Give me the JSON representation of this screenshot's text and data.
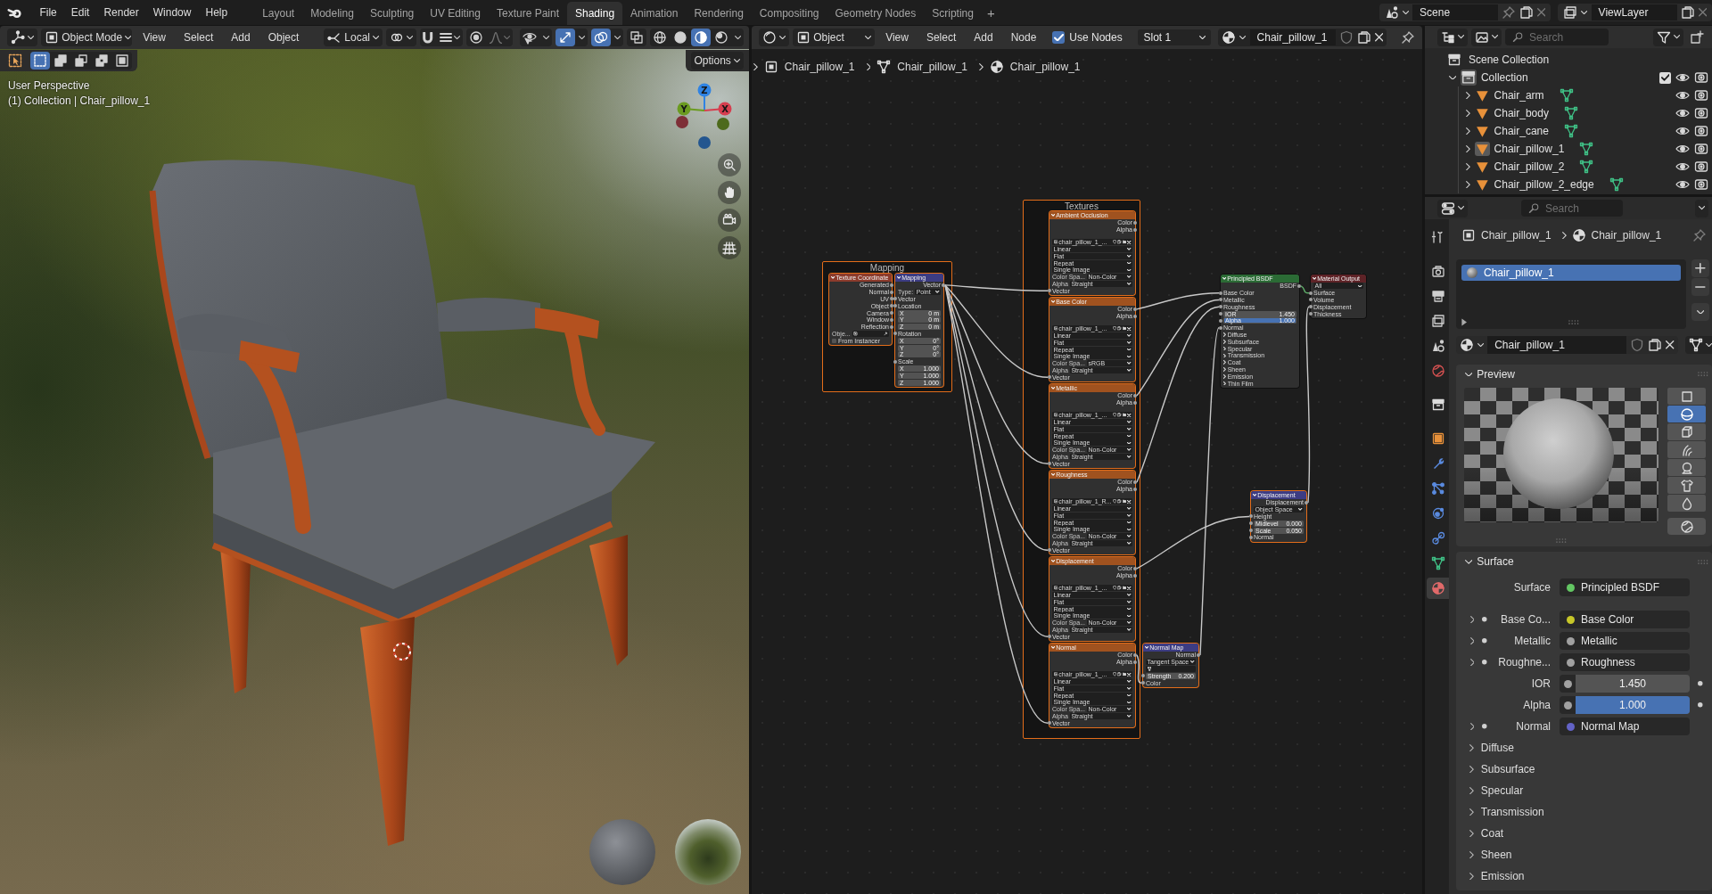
{
  "topbar": {
    "menus": [
      "File",
      "Edit",
      "Render",
      "Window",
      "Help"
    ],
    "workspaces": [
      {
        "label": "Layout",
        "selected": false
      },
      {
        "label": "Modeling",
        "selected": false
      },
      {
        "label": "Sculpting",
        "selected": false
      },
      {
        "label": "UV Editing",
        "selected": false
      },
      {
        "label": "Texture Paint",
        "selected": false
      },
      {
        "label": "Shading",
        "selected": true
      },
      {
        "label": "Animation",
        "selected": false
      },
      {
        "label": "Rendering",
        "selected": false
      },
      {
        "label": "Compositing",
        "selected": false
      },
      {
        "label": "Geometry Nodes",
        "selected": false
      },
      {
        "label": "Scripting",
        "selected": false
      }
    ],
    "add_workspace": "+",
    "scene": "Scene",
    "view_layer": "ViewLayer"
  },
  "viewport": {
    "mode": "Object Mode",
    "menus": [
      "View",
      "Select",
      "Add",
      "Object"
    ],
    "orientation": "Local",
    "toggles": [
      {
        "kind": "visibility",
        "selected": false
      },
      {
        "kind": "gizmo",
        "selected": true
      },
      {
        "kind": "overlay",
        "selected": true
      },
      {
        "kind": "xray",
        "selected": false
      }
    ],
    "shading": [
      {
        "kind": "wireframe",
        "selected": false
      },
      {
        "kind": "solid",
        "selected": false
      },
      {
        "kind": "material",
        "selected": true
      },
      {
        "kind": "rendered",
        "selected": false
      }
    ],
    "select_modes": [
      {
        "kind": "set",
        "selected": true
      },
      {
        "kind": "extend",
        "selected": false
      },
      {
        "kind": "subtract",
        "selected": false
      },
      {
        "kind": "invert",
        "selected": false
      },
      {
        "kind": "intersect",
        "selected": false
      }
    ],
    "options": "Options",
    "view_name": "User Perspective",
    "context": "(1) Collection | Chair_pillow_1",
    "axes": [
      "Z",
      "Y",
      "X"
    ]
  },
  "node_editor": {
    "object_type": "Object",
    "menus": [
      "View",
      "Select",
      "Add",
      "Node"
    ],
    "use_nodes": {
      "label": "Use Nodes",
      "checked": true
    },
    "slot": "Slot 1",
    "material": "Chair_pillow_1",
    "breadcrumbs": [
      {
        "kind": "object",
        "label": "Chair_pillow_1"
      },
      {
        "kind": "mesh",
        "label": "Chair_pillow_1"
      },
      {
        "kind": "material",
        "label": "Chair_pillow_1"
      }
    ],
    "frames": [
      {
        "label": "Mapping",
        "selected": true,
        "nodes": [
          {
            "title": "Texture Coordinate",
            "color": "#8c3b2c",
            "selected": true,
            "rows": [
              {
                "kind": "out",
                "label": "Generated"
              },
              {
                "kind": "out",
                "label": "Normal"
              },
              {
                "kind": "out",
                "label": "UV"
              },
              {
                "kind": "out",
                "label": "Object"
              },
              {
                "kind": "out",
                "label": "Camera"
              },
              {
                "kind": "out",
                "label": "Window"
              },
              {
                "kind": "out",
                "label": "Reflection"
              },
              {
                "kind": "object",
                "label": "Obje..."
              },
              {
                "kind": "check",
                "label": "From Instancer",
                "checked": false
              }
            ]
          },
          {
            "title": "Mapping",
            "color": "#3c3c83",
            "selected": true,
            "rows": [
              {
                "kind": "out",
                "label": "Vector"
              },
              {
                "kind": "field",
                "label": "Type:",
                "value": "Point"
              },
              {
                "kind": "in",
                "label": "Vector"
              },
              {
                "kind": "in",
                "label": "Location"
              },
              {
                "kind": "value",
                "label": "X",
                "value": "0 m"
              },
              {
                "kind": "value",
                "label": "Y",
                "value": "0 m"
              },
              {
                "kind": "value",
                "label": "Z",
                "value": "0 m"
              },
              {
                "kind": "in",
                "label": "Rotation"
              },
              {
                "kind": "value",
                "label": "X",
                "value": "0°"
              },
              {
                "kind": "value",
                "label": "Y",
                "value": "0°"
              },
              {
                "kind": "value",
                "label": "Z",
                "value": "0°"
              },
              {
                "kind": "in",
                "label": "Scale"
              },
              {
                "kind": "value",
                "label": "X",
                "value": "1.000"
              },
              {
                "kind": "value",
                "label": "Y",
                "value": "1.000"
              },
              {
                "kind": "value",
                "label": "Z",
                "value": "1.000"
              }
            ]
          }
        ]
      },
      {
        "label": "Textures",
        "selected": true,
        "nodes": [
          {
            "title": "Ambient Occlusion",
            "color": "#a0521f",
            "selected": true,
            "rows": [
              {
                "kind": "out",
                "label": "Color"
              },
              {
                "kind": "out",
                "label": "Alpha"
              },
              {
                "kind": "image",
                "value": "chair_pillow_1_..."
              },
              {
                "kind": "field",
                "value": "Linear"
              },
              {
                "kind": "field",
                "value": "Flat"
              },
              {
                "kind": "field",
                "value": "Repeat"
              },
              {
                "kind": "field",
                "value": "Single Image"
              },
              {
                "kind": "field",
                "label": "Color Spa...",
                "value": "Non-Color"
              },
              {
                "kind": "field",
                "label": "Alpha",
                "value": "Straight"
              },
              {
                "kind": "in",
                "label": "Vector"
              }
            ]
          },
          {
            "title": "Base Color",
            "color": "#a0521f",
            "selected": true,
            "rows": [
              {
                "kind": "out",
                "label": "Color"
              },
              {
                "kind": "out",
                "label": "Alpha"
              },
              {
                "kind": "image",
                "value": "chair_pillow_1_..."
              },
              {
                "kind": "field",
                "value": "Linear"
              },
              {
                "kind": "field",
                "value": "Flat"
              },
              {
                "kind": "field",
                "value": "Repeat"
              },
              {
                "kind": "field",
                "value": "Single Image"
              },
              {
                "kind": "field",
                "label": "Color Spa...",
                "value": "sRGB"
              },
              {
                "kind": "field",
                "label": "Alpha",
                "value": "Straight"
              },
              {
                "kind": "in",
                "label": "Vector"
              }
            ]
          },
          {
            "title": "Metallic",
            "color": "#a0521f",
            "selected": true,
            "rows": [
              {
                "kind": "out",
                "label": "Color"
              },
              {
                "kind": "out",
                "label": "Alpha"
              },
              {
                "kind": "image",
                "value": "chair_pillow_1_..."
              },
              {
                "kind": "field",
                "value": "Linear"
              },
              {
                "kind": "field",
                "value": "Flat"
              },
              {
                "kind": "field",
                "value": "Repeat"
              },
              {
                "kind": "field",
                "value": "Single Image"
              },
              {
                "kind": "field",
                "label": "Color Spa...",
                "value": "Non-Color"
              },
              {
                "kind": "field",
                "label": "Alpha",
                "value": "Straight"
              },
              {
                "kind": "in",
                "label": "Vector"
              }
            ]
          },
          {
            "title": "Roughness",
            "color": "#a0521f",
            "selected": true,
            "rows": [
              {
                "kind": "out",
                "label": "Color"
              },
              {
                "kind": "out",
                "label": "Alpha"
              },
              {
                "kind": "image",
                "value": "chair_pillow_1_R..."
              },
              {
                "kind": "field",
                "value": "Linear"
              },
              {
                "kind": "field",
                "value": "Flat"
              },
              {
                "kind": "field",
                "value": "Repeat"
              },
              {
                "kind": "field",
                "value": "Single Image"
              },
              {
                "kind": "field",
                "label": "Color Spa...",
                "value": "Non-Color"
              },
              {
                "kind": "field",
                "label": "Alpha",
                "value": "Straight"
              },
              {
                "kind": "in",
                "label": "Vector"
              }
            ]
          },
          {
            "title": "Displacement",
            "color": "#a0521f",
            "selected": true,
            "rows": [
              {
                "kind": "out",
                "label": "Color"
              },
              {
                "kind": "out",
                "label": "Alpha"
              },
              {
                "kind": "image",
                "value": "chair_pillow_1_..."
              },
              {
                "kind": "field",
                "value": "Linear"
              },
              {
                "kind": "field",
                "value": "Flat"
              },
              {
                "kind": "field",
                "value": "Repeat"
              },
              {
                "kind": "field",
                "value": "Single Image"
              },
              {
                "kind": "field",
                "label": "Color Spa...",
                "value": "Non-Color"
              },
              {
                "kind": "field",
                "label": "Alpha",
                "value": "Straight"
              },
              {
                "kind": "in",
                "label": "Vector"
              }
            ]
          },
          {
            "title": "Normal",
            "color": "#a0521f",
            "selected": true,
            "rows": [
              {
                "kind": "out",
                "label": "Color"
              },
              {
                "kind": "out",
                "label": "Alpha"
              },
              {
                "kind": "image",
                "value": "chair_pillow_1_..."
              },
              {
                "kind": "field",
                "value": "Linear"
              },
              {
                "kind": "field",
                "value": "Flat"
              },
              {
                "kind": "field",
                "value": "Repeat"
              },
              {
                "kind": "field",
                "value": "Single Image"
              },
              {
                "kind": "field",
                "label": "Color Spa...",
                "value": "Non-Color"
              },
              {
                "kind": "field",
                "label": "Alpha",
                "value": "Straight"
              },
              {
                "kind": "in",
                "label": "Vector"
              }
            ]
          }
        ]
      }
    ],
    "nodes": [
      {
        "title": "Principled BSDF",
        "color": "#2b6b35",
        "selected": false,
        "rows": [
          {
            "kind": "out",
            "label": "BSDF"
          },
          {
            "kind": "in",
            "label": "Base Color"
          },
          {
            "kind": "in",
            "label": "Metallic"
          },
          {
            "kind": "in",
            "label": "Roughness"
          },
          {
            "kind": "in_value",
            "label": "IOR",
            "value": "1.450"
          },
          {
            "kind": "in_value",
            "label": "Alpha",
            "value": "1.000",
            "level": 1
          },
          {
            "kind": "in",
            "label": "Normal"
          },
          {
            "kind": "panel",
            "label": "Diffuse"
          },
          {
            "kind": "panel",
            "label": "Subsurface"
          },
          {
            "kind": "panel",
            "label": "Specular"
          },
          {
            "kind": "panel",
            "label": "Transmission"
          },
          {
            "kind": "panel",
            "label": "Coat"
          },
          {
            "kind": "panel",
            "label": "Sheen"
          },
          {
            "kind": "panel",
            "label": "Emission"
          },
          {
            "kind": "panel",
            "label": "Thin Film"
          }
        ]
      },
      {
        "title": "Material Output",
        "color": "#5e2327",
        "selected": false,
        "rows": [
          {
            "kind": "field",
            "value": "All"
          },
          {
            "kind": "in",
            "label": "Surface"
          },
          {
            "kind": "in",
            "label": "Volume"
          },
          {
            "kind": "in",
            "label": "Displacement"
          },
          {
            "kind": "in",
            "label": "Thickness"
          }
        ]
      },
      {
        "title": "Displacement",
        "color": "#3c3c83",
        "selected": true,
        "rows": [
          {
            "kind": "out",
            "label": "Displacement"
          },
          {
            "kind": "field",
            "value": "Object Space"
          },
          {
            "kind": "in",
            "label": "Height"
          },
          {
            "kind": "in_value",
            "label": "Midlevel",
            "value": "0.000"
          },
          {
            "kind": "in_value",
            "label": "Scale",
            "value": "0.050"
          },
          {
            "kind": "in",
            "label": "Normal"
          }
        ]
      },
      {
        "title": "Normal Map",
        "color": "#3c3c83",
        "selected": true,
        "rows": [
          {
            "kind": "out",
            "label": "Normal"
          },
          {
            "kind": "field",
            "value": "Tangent Space"
          },
          {
            "kind": "uv"
          },
          {
            "kind": "in_value",
            "label": "Strength",
            "value": "0.200"
          },
          {
            "kind": "in",
            "label": "Color"
          }
        ]
      }
    ]
  },
  "outliner": {
    "search_placeholder": "Search",
    "root": "Scene Collection",
    "collections": [
      {
        "label": "Collection",
        "expanded": true,
        "checked": true,
        "children": [
          {
            "label": "Chair_arm",
            "selected": false
          },
          {
            "label": "Chair_body",
            "selected": false
          },
          {
            "label": "Chair_cane",
            "selected": false
          },
          {
            "label": "Chair_pillow_1",
            "selected": true
          },
          {
            "label": "Chair_pillow_2",
            "selected": false
          },
          {
            "label": "Chair_pillow_2_edge",
            "selected": false
          }
        ]
      }
    ]
  },
  "properties": {
    "search_placeholder": "Search",
    "tabs": [
      {
        "kind": "tool",
        "selected": false
      },
      {
        "kind": "render",
        "selected": false
      },
      {
        "kind": "output",
        "selected": false
      },
      {
        "kind": "view_layer",
        "selected": false
      },
      {
        "kind": "scene",
        "selected": false
      },
      {
        "kind": "world",
        "selected": false
      },
      {
        "kind": "collection",
        "selected": false
      },
      {
        "kind": "object",
        "selected": false
      },
      {
        "kind": "modifiers",
        "selected": false
      },
      {
        "kind": "particles",
        "selected": false
      },
      {
        "kind": "physics",
        "selected": false
      },
      {
        "kind": "constraints",
        "selected": false
      },
      {
        "kind": "data",
        "selected": false
      },
      {
        "kind": "material",
        "selected": true
      }
    ],
    "breadcrumbs": [
      {
        "kind": "object",
        "label": "Chair_pillow_1"
      },
      {
        "kind": "material",
        "label": "Chair_pillow_1"
      }
    ],
    "material_slots": [
      {
        "label": "Chair_pillow_1",
        "selected": true
      }
    ],
    "material": "Chair_pillow_1",
    "preview": {
      "title": "Preview",
      "expanded": true,
      "shapes": [
        {
          "kind": "plane",
          "selected": false
        },
        {
          "kind": "sphere",
          "selected": true
        },
        {
          "kind": "cube",
          "selected": false
        },
        {
          "kind": "hair",
          "selected": false
        },
        {
          "kind": "monkey",
          "selected": false
        },
        {
          "kind": "cloth",
          "selected": false
        },
        {
          "kind": "fluid",
          "selected": false
        }
      ]
    },
    "surface": {
      "title": "Surface",
      "expanded": true,
      "shader": {
        "label": "Surface",
        "value": "Principled BSDF",
        "color": "#63c763"
      },
      "inputs": [
        {
          "kind": "link",
          "label": "Base Co...",
          "value": "Base Color",
          "color": "#c7c729"
        },
        {
          "kind": "link",
          "label": "Metallic",
          "value": "Metallic",
          "color": "#a1a1a1"
        },
        {
          "kind": "link",
          "label": "Roughne...",
          "value": "Roughness",
          "color": "#a1a1a1"
        },
        {
          "kind": "number",
          "label": "IOR",
          "value": "1.450",
          "color": "#a1a1a1"
        },
        {
          "kind": "factor",
          "label": "Alpha",
          "value": "1.000",
          "level": 1,
          "color": "#a1a1a1"
        },
        {
          "kind": "link",
          "label": "Normal",
          "value": "Normal Map",
          "color": "#6363c7"
        }
      ],
      "panels": [
        {
          "label": "Diffuse",
          "expanded": false
        },
        {
          "label": "Subsurface",
          "expanded": false
        },
        {
          "label": "Specular",
          "expanded": false
        },
        {
          "label": "Transmission",
          "expanded": false
        },
        {
          "label": "Coat",
          "expanded": false
        },
        {
          "label": "Sheen",
          "expanded": false
        },
        {
          "label": "Emission",
          "expanded": false
        }
      ]
    }
  }
}
